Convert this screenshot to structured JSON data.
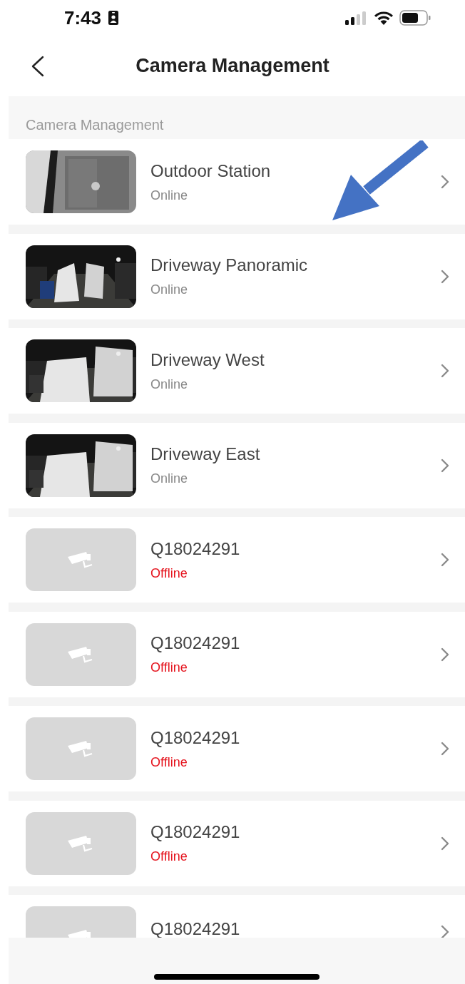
{
  "status_bar": {
    "time": "7:43"
  },
  "nav": {
    "title": "Camera Management"
  },
  "section": {
    "title": "Camera Management"
  },
  "cameras": [
    {
      "name": "Outdoor Station",
      "status": "Online",
      "online": true,
      "kind": "picture"
    },
    {
      "name": "Driveway Panoramic",
      "status": "Online",
      "online": true,
      "kind": "picture"
    },
    {
      "name": "Driveway West",
      "status": "Online",
      "online": true,
      "kind": "picture"
    },
    {
      "name": "Driveway East",
      "status": "Online",
      "online": true,
      "kind": "picture"
    },
    {
      "name": "Q18024291",
      "status": "Offline",
      "online": false,
      "kind": "placeholder"
    },
    {
      "name": "Q18024291",
      "status": "Offline",
      "online": false,
      "kind": "placeholder"
    },
    {
      "name": "Q18024291",
      "status": "Offline",
      "online": false,
      "kind": "placeholder"
    },
    {
      "name": "Q18024291",
      "status": "Offline",
      "online": false,
      "kind": "placeholder"
    },
    {
      "name": "Q18024291",
      "kind": "placeholder"
    }
  ]
}
